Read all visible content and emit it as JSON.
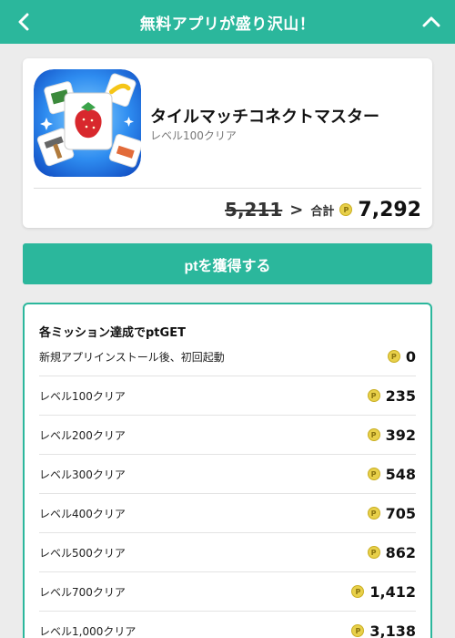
{
  "header": {
    "title": "無料アプリが盛り沢山！",
    "back_icon": "chevron-left-icon",
    "collapse_icon": "chevron-up-icon",
    "color": "#2bb79c"
  },
  "app": {
    "name": "タイルマッチコネクトマスター",
    "subtitle": "レベル100クリア",
    "old_points": "5,211",
    "arrow": ">",
    "total_label": "合計",
    "total_points": "7,292",
    "coin_glyph": "P"
  },
  "cta": {
    "label": "ptを獲得する"
  },
  "missions": {
    "title": "各ミッション達成でptGET",
    "rows": [
      {
        "label": "新規アプリインストール後、初回起動",
        "points": "0"
      },
      {
        "label": "レベル100クリア",
        "points": "235"
      },
      {
        "label": "レベル200クリア",
        "points": "392"
      },
      {
        "label": "レベル300クリア",
        "points": "548"
      },
      {
        "label": "レベル400クリア",
        "points": "705"
      },
      {
        "label": "レベル500クリア",
        "points": "862"
      },
      {
        "label": "レベル700クリア",
        "points": "1,412"
      },
      {
        "label": "レベル1,000クリア",
        "points": "3,138"
      }
    ]
  },
  "colors": {
    "accent": "#2bb79c",
    "coin": "#e8d04a"
  }
}
